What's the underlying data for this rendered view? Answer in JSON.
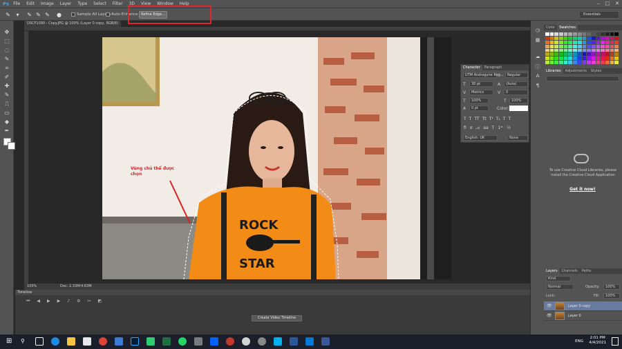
{
  "app": {
    "logo": "Ps"
  },
  "menu": [
    "File",
    "Edit",
    "Image",
    "Layer",
    "Type",
    "Select",
    "Filter",
    "3D",
    "View",
    "Window",
    "Help"
  ],
  "options": {
    "sample_all_layers": "Sample All Layers",
    "auto_enhance": "Auto-Enhance",
    "refine_edge": "Refine Edge...",
    "workspace": "Essentials"
  },
  "document": {
    "tab_title": "DSCF1090 - Copy.JPG @ 100% (Layer 0 copy, RGB/8)",
    "zoom": "100%",
    "doc_size": "Doc: 2.33M/4.63M"
  },
  "annotation": {
    "line1": "Vùng chủ thể được",
    "line2": "chọn",
    "color": "#e21e26"
  },
  "timeline": {
    "tab": "Timeline",
    "create_button": "Create Video Timeline"
  },
  "panels": {
    "color_tabs": [
      "Color",
      "Swatches"
    ],
    "library_tabs": [
      "Libraries",
      "Adjustments",
      "Styles"
    ],
    "cc_message": "To use Creative Cloud Libraries, please install the Creative Cloud Application",
    "cc_link": "Get it now!",
    "layer_tabs": [
      "Layers",
      "Channels",
      "Paths"
    ],
    "layer_filter": "Kind",
    "blend_mode": "Normal",
    "opacity_label": "Opacity:",
    "opacity_value": "100%",
    "lock_label": "Lock:",
    "fill_label": "Fill:",
    "fill_value": "100%",
    "layers": [
      "Layer 0 copy",
      "Layer 0"
    ]
  },
  "character": {
    "tabs": [
      "Character",
      "Paragraph"
    ],
    "font": "UTM Androgyne Reg...",
    "style": "Regular",
    "size": "30 pt",
    "leading": "(Auto)",
    "kerning": "Metrics",
    "tracking": "0",
    "vscale": "100%",
    "hscale": "100%",
    "baseline": "0 pt",
    "color_label": "Color:",
    "language": "English: UK",
    "antialias": "None"
  },
  "taskbar": {
    "language": "ENG",
    "time": "2:01 PM",
    "date": "4/4/2021"
  }
}
